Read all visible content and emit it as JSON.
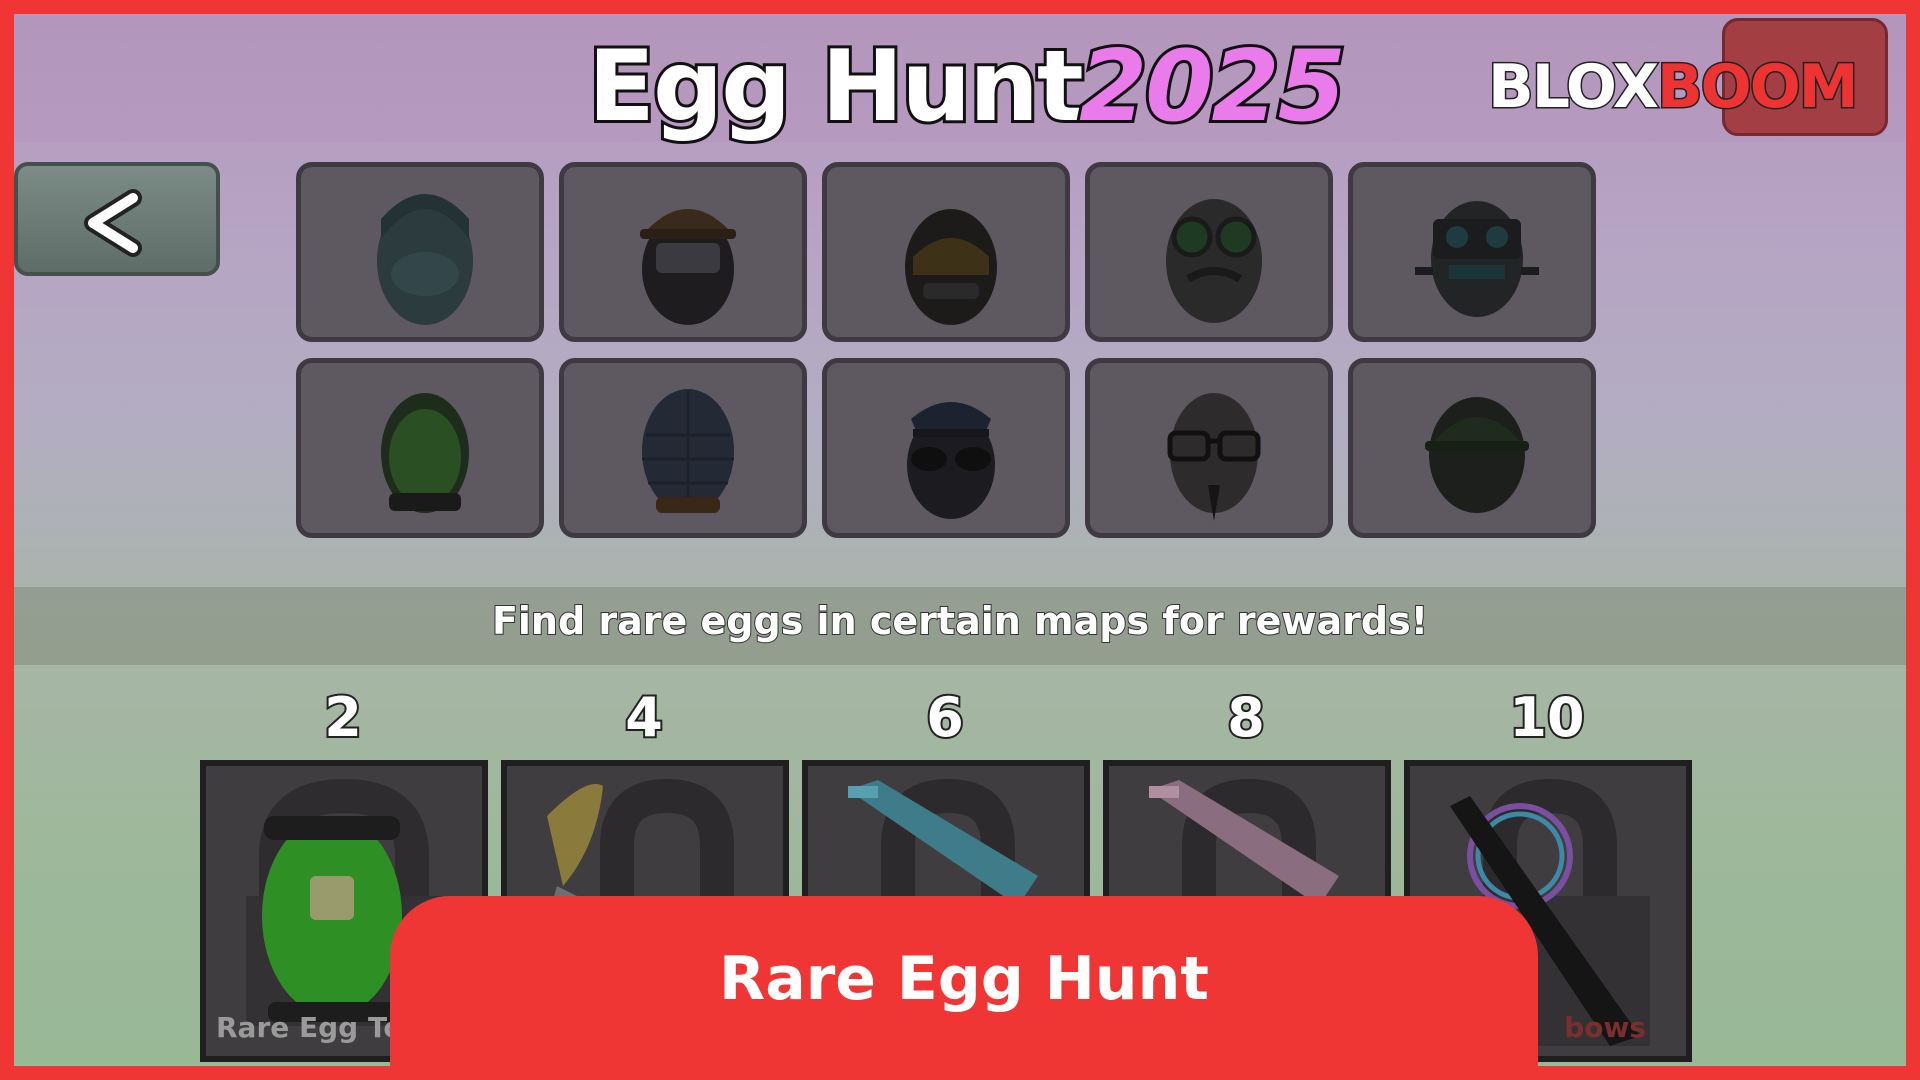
{
  "header": {
    "title": "Egg Hunt",
    "year": "2025",
    "logo_part1": "BLOX",
    "logo_part2": "BOOM"
  },
  "eggs": {
    "row1": [
      "hooded-egg",
      "hardhat-egg",
      "visor-egg",
      "goggles-egg",
      "robot-egg"
    ],
    "row2": [
      "toxic-egg",
      "scaled-egg",
      "police-egg",
      "glasses-egg",
      "helmet-egg"
    ]
  },
  "hint": "Find rare eggs in certain maps for rewards!",
  "rewards": [
    {
      "count": "2",
      "name": "Rare Egg To",
      "icon": "toxic-egg-pet-icon"
    },
    {
      "count": "4",
      "name": "",
      "icon": "banana-knife-icon"
    },
    {
      "count": "6",
      "name": "",
      "icon": "blue-gun-icon"
    },
    {
      "count": "8",
      "name": "",
      "icon": "pink-gun-icon"
    },
    {
      "count": "10",
      "name": "bows",
      "icon": "rainbow-knife-icon"
    }
  ],
  "banner": {
    "text": "Rare Egg Hunt"
  },
  "colors": {
    "frame": "#f03535",
    "slot": "#5e5860",
    "year": "#ea7bea"
  }
}
